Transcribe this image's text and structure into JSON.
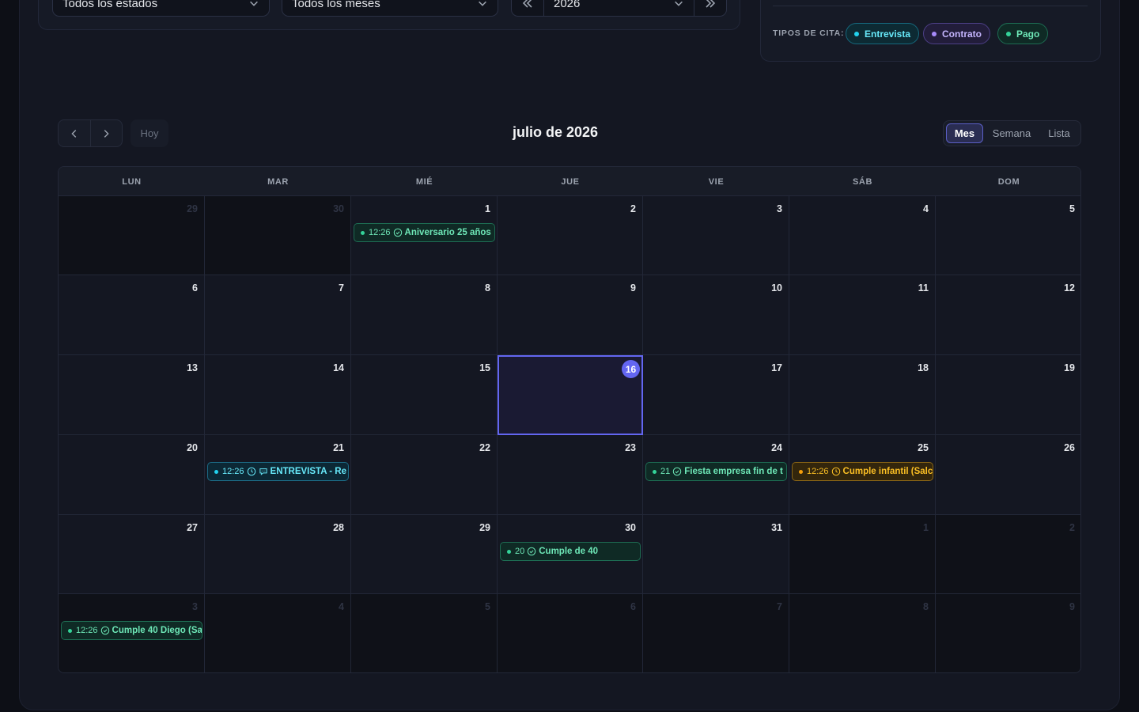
{
  "filters": {
    "status_select": "Todos los estados",
    "month_select": "Todos los meses",
    "year_select": "2026"
  },
  "types": {
    "label": "TIPOS DE CITA:",
    "items": [
      {
        "label": "Entrevista",
        "color": "#22d3ee"
      },
      {
        "label": "Contrato",
        "color": "#a78bfa"
      },
      {
        "label": "Pago",
        "color": "#34d399"
      }
    ]
  },
  "calendar": {
    "title": "julio de 2026",
    "today_label": "Hoy",
    "views": [
      "Mes",
      "Semana",
      "Lista"
    ],
    "active_view": "Mes",
    "weekdays": [
      "LUN",
      "MAR",
      "MIÉ",
      "JUE",
      "VIE",
      "SÁB",
      "DOM"
    ],
    "weeks": [
      [
        "29",
        "30",
        "1",
        "2",
        "3",
        "4",
        "5"
      ],
      [
        "6",
        "7",
        "8",
        "9",
        "10",
        "11",
        "12"
      ],
      [
        "13",
        "14",
        "15",
        "16",
        "17",
        "18",
        "19"
      ],
      [
        "20",
        "21",
        "22",
        "23",
        "24",
        "25",
        "26"
      ],
      [
        "27",
        "28",
        "29",
        "30",
        "31",
        "1",
        "2"
      ],
      [
        "3",
        "4",
        "5",
        "6",
        "7",
        "8",
        "9"
      ]
    ],
    "today": "16",
    "events": [
      {
        "time": "12:26",
        "title": "Aniversario 25 años",
        "style": "green",
        "icon": "check-circle"
      },
      {
        "time": "12:26",
        "title": "ENTREVISTA - Re",
        "style": "cyan",
        "icon": "clock"
      },
      {
        "time": "21",
        "title": "Fiesta empresa fin de t",
        "style": "green",
        "icon": "check-circle"
      },
      {
        "time": "12:26",
        "title": "Cumple infantil (Salc",
        "style": "amber",
        "icon": "clock"
      },
      {
        "time": "20",
        "title": "Cumple de 40",
        "style": "green",
        "icon": "check-circle"
      },
      {
        "time": "12:26",
        "title": "Cumple 40 Diego (Sa",
        "style": "green",
        "icon": "check-circle"
      }
    ]
  }
}
